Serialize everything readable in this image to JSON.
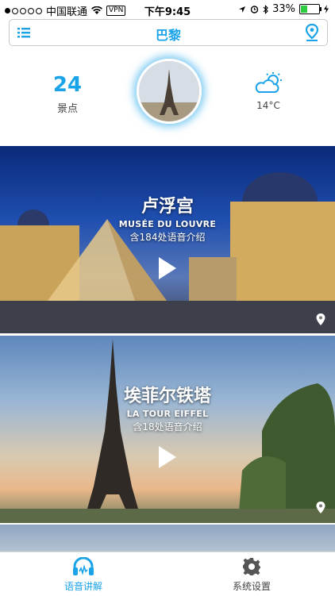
{
  "status_bar": {
    "carrier": "中国联通",
    "vpn": "VPN",
    "time": "下午9:45",
    "battery": "33%"
  },
  "nav": {
    "title": "巴黎",
    "menu_icon": "list-icon",
    "location_icon": "map-pin-icon"
  },
  "stats": {
    "count": "24",
    "count_label": "景点",
    "weather_icon": "partly-cloudy-icon",
    "temperature": "14°C"
  },
  "cards": [
    {
      "title_cn": "卢浮宫",
      "title_fr": "MUSÉE DU LOUVRE",
      "audio_count": "含184处语音介绍"
    },
    {
      "title_cn": "埃菲尔铁塔",
      "title_fr": "LA TOUR EIFFEL",
      "audio_count": "含18处语音介绍"
    }
  ],
  "tabs": [
    {
      "label": "语音讲解",
      "icon": "headphones-icon",
      "active": true
    },
    {
      "label": "系统设置",
      "icon": "gear-icon",
      "active": false
    }
  ],
  "colors": {
    "accent": "#1aa3e8"
  }
}
